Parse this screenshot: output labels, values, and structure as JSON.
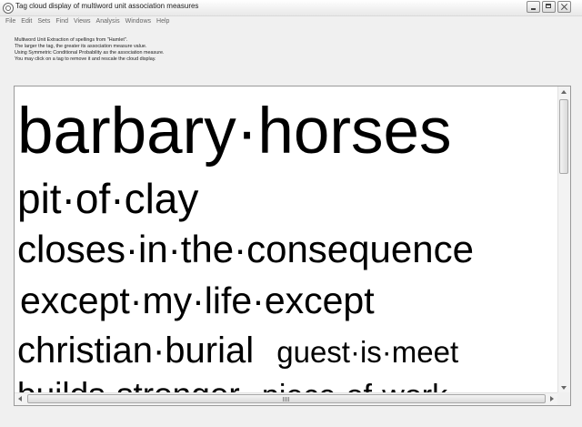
{
  "window": {
    "title": "Tag cloud display of multiword unit association measures"
  },
  "menu": {
    "items": [
      "File",
      "Edit",
      "Sets",
      "Find",
      "Views",
      "Analysis",
      "Windows",
      "Help"
    ]
  },
  "info": {
    "lines": [
      "Multiword Unit Extraction of spellings from \"Hamlet\".",
      "The larger the tag, the greater its association measure value.",
      "Using Symmetric Conditional Probability as the association measure.",
      "You may click on a tag to remove it and rescale the cloud display."
    ]
  },
  "cloud": {
    "tags": [
      "barbary·horses",
      "pit·of·clay",
      "closes·in·the·consequence",
      "except·my·life·except",
      "christian·burial",
      "guest·is·meet",
      "builds·stronger",
      "piece·of·work"
    ]
  }
}
